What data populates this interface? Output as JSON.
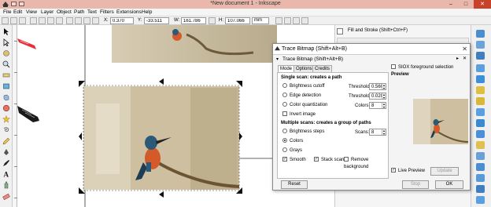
{
  "window": {
    "title": "*New document 1 - Inkscape",
    "minimize": "–",
    "maximize": "□",
    "close": "✕"
  },
  "menu": [
    "File",
    "Edit",
    "View",
    "Layer",
    "Object",
    "Path",
    "Text",
    "Filters",
    "Extensions",
    "Help"
  ],
  "controls": {
    "x_label": "X:",
    "x_value": "0.370",
    "y_label": "Y:",
    "y_value": "-33.511",
    "w_label": "W:",
    "w_value": "161.786",
    "h_label": "H:",
    "h_value": "107.066",
    "unit": "mm"
  },
  "fill_stroke_tab": "Fill and Stroke (Shift+Ctrl+F)",
  "trace": {
    "title": "Trace Bitmap (Shift+Alt+B)",
    "inner_title": "Trace Bitmap (Shift+Alt+B)",
    "tabs": [
      "Mode",
      "Options",
      "Credits"
    ],
    "single_header": "Single scan: creates a path",
    "brightness_cutoff": "Brightness cutoff",
    "threshold_label": "Threshold:",
    "threshold_value": "0.560",
    "edge_detection": "Edge detection",
    "threshold2_label": "Threshold:",
    "threshold2_value": "0.020",
    "color_quantization": "Color quantization",
    "colors_label": "Colors:",
    "colors_value": "8",
    "invert_image": "Invert image",
    "multi_header": "Multiple scans: creates a group of paths",
    "brightness_steps": "Brightness steps",
    "scans_label": "Scans:",
    "scans_value": "8",
    "colors": "Colors",
    "grays": "Grays",
    "smooth": "Smooth",
    "stack_scans": "Stack scans",
    "remove_background": "Remove background",
    "siox": "SIOX foreground selection",
    "preview": "Preview",
    "live_preview": "Live Preview",
    "update": "Update",
    "reset": "Reset",
    "stop": "Stop",
    "ok": "OK"
  },
  "colors": {
    "titlebar": "#e9b7ab",
    "close": "#c7412b",
    "bird_orange": "#d45a2a",
    "bird_blue": "#2a5a78",
    "bg_beige": "#c8bd9c"
  }
}
